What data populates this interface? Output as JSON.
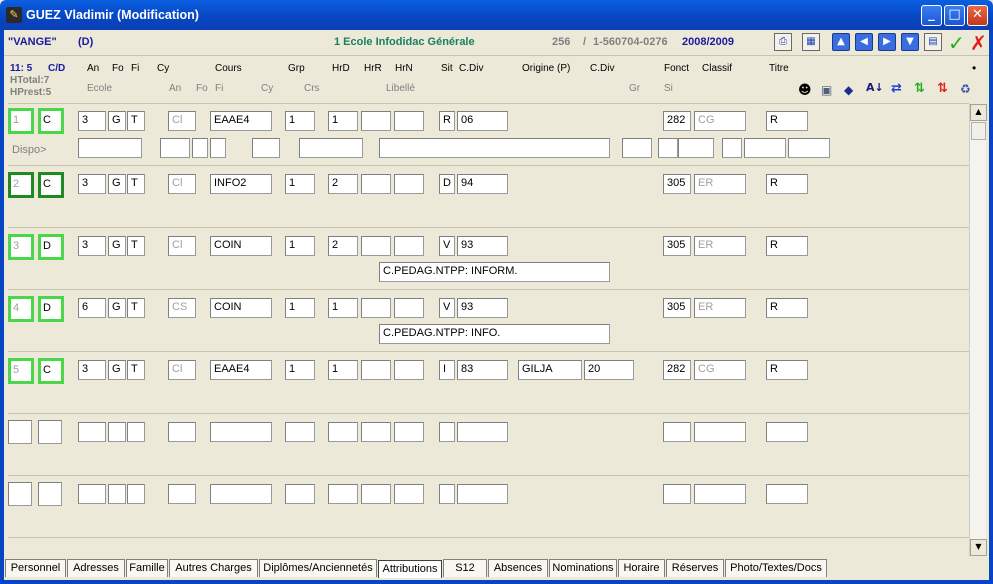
{
  "window": {
    "title": "GUEZ Vladimir (Modification)"
  },
  "info": {
    "code": "\"VANGE\"",
    "mode": "(D)",
    "school": "1 Ecole Infodidac Générale",
    "num": "256",
    "slash": "/",
    "ref": "1-560704-0276",
    "year": "2008/2009"
  },
  "summary": {
    "counter": "11: 5",
    "cd": "C/D",
    "htotal": "HTotal:7",
    "hprest": "HPrest:5",
    "dot": "•"
  },
  "headers": {
    "an": "An",
    "fo": "Fo",
    "fi": "Fi",
    "cy": "Cy",
    "cours": "Cours",
    "grp": "Grp",
    "hrd": "HrD",
    "hrr": "HrR",
    "hrn": "HrN",
    "sit": "Sit",
    "cdiv": "C.Div",
    "origine": "Origine (P)",
    "cdiv2": "C.Div",
    "fonct": "Fonct",
    "classif": "Classif",
    "titre": "Titre",
    "ecole": "Ecole",
    "an2": "An",
    "fo2": "Fo",
    "fi2": "Fi",
    "cy2": "Cy",
    "crs": "Crs",
    "libelle": "Libellé",
    "gr": "Gr",
    "si": "Si"
  },
  "dispo_label": "Dispo>",
  "rows": [
    {
      "num": "1",
      "cd": "C",
      "an": "3",
      "fo": "G",
      "fi": "T",
      "cy": "Cl",
      "cours": "EAAE4",
      "grp": "1",
      "hrd": "1",
      "hrr": "",
      "hrn": "",
      "sit": "R",
      "cdiv": "06",
      "orig": "",
      "cdiv2": "",
      "fonct": "282",
      "classif": "CG",
      "titre": "R",
      "note": ""
    },
    {
      "num": "2",
      "cd": "C",
      "an": "3",
      "fo": "G",
      "fi": "T",
      "cy": "Cl",
      "cours": "INFO2",
      "grp": "1",
      "hrd": "2",
      "hrr": "",
      "hrn": "",
      "sit": "D",
      "cdiv": "94",
      "orig": "",
      "cdiv2": "",
      "fonct": "305",
      "classif": "ER",
      "titre": "R",
      "note": ""
    },
    {
      "num": "3",
      "cd": "D",
      "an": "3",
      "fo": "G",
      "fi": "T",
      "cy": "Cl",
      "cours": "COIN",
      "grp": "1",
      "hrd": "2",
      "hrr": "",
      "hrn": "",
      "sit": "V",
      "cdiv": "93",
      "orig": "",
      "cdiv2": "",
      "fonct": "305",
      "classif": "ER",
      "titre": "R",
      "note": "C.PEDAG.NTPP: INFORM."
    },
    {
      "num": "4",
      "cd": "D",
      "an": "6",
      "fo": "G",
      "fi": "T",
      "cy": "CS",
      "cours": "COIN",
      "grp": "1",
      "hrd": "1",
      "hrr": "",
      "hrn": "",
      "sit": "V",
      "cdiv": "93",
      "orig": "",
      "cdiv2": "",
      "fonct": "305",
      "classif": "ER",
      "titre": "R",
      "note": "C.PEDAG.NTPP: INFO."
    },
    {
      "num": "5",
      "cd": "C",
      "an": "3",
      "fo": "G",
      "fi": "T",
      "cy": "Cl",
      "cours": "EAAE4",
      "grp": "1",
      "hrd": "1",
      "hrr": "",
      "hrn": "",
      "sit": "I",
      "cdiv": "83",
      "orig": "GILJA",
      "cdiv2": "20",
      "fonct": "282",
      "classif": "CG",
      "titre": "R",
      "note": ""
    }
  ],
  "tabs": [
    "Personnel",
    "Adresses",
    "Famille",
    "Autres Charges",
    "Diplômes/Anciennetés",
    "Attributions",
    "S12",
    "Absences",
    "Nominations",
    "Horaire",
    "Réserves",
    "Photo/Textes/Docs"
  ],
  "active_tab": "Attributions",
  "colors": {
    "title_bar": "#0845c2",
    "green_border": "#4ad84a",
    "dark_green_border": "#1f8a1f",
    "school": "#1a8060",
    "navy": "#1a1aa0"
  }
}
